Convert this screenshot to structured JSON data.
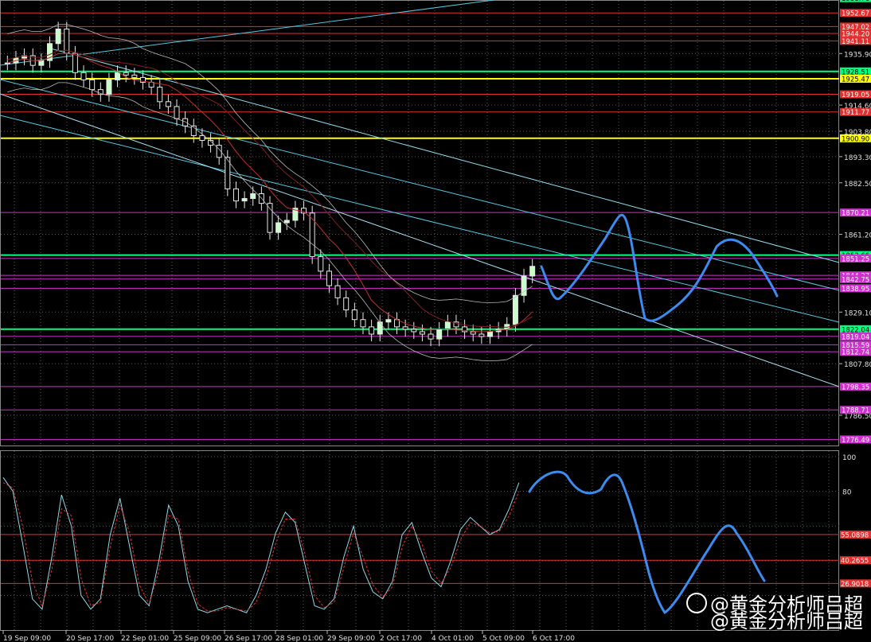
{
  "chart_data": [
    {
      "type": "candlestick",
      "title": "",
      "x_ticks": [
        "19 Sep 09:00",
        "20 Sep 17:00",
        "22 Sep 01:00",
        "25 Sep 09:00",
        "26 Sep 17:00",
        "28 Sep 01:00",
        "29 Sep 09:00",
        "2 Oct 17:00",
        "4 Oct 01:00",
        "5 Oct 09:00",
        "6 Oct 17:00"
      ],
      "y_ticks": [
        1935.9,
        1914.6,
        1903.8,
        1893.3,
        1882.5,
        1861.2,
        1829.1,
        1807.8,
        1786.5
      ],
      "ylim": [
        1774.0,
        1958.0
      ],
      "price_levels": [
        {
          "value": 1958.76,
          "label": "1958.76",
          "color": "#00ff7f"
        },
        {
          "value": 1952.67,
          "label": "1952.67",
          "color": "#e03030"
        },
        {
          "value": 1947.02,
          "label": "1947.02",
          "color": "#e03030"
        },
        {
          "value": 1944.2,
          "label": "1944.20",
          "color": "#e03030"
        },
        {
          "value": 1941.11,
          "label": "1941.11",
          "color": "#e03030"
        },
        {
          "value": 1928.51,
          "label": "1928.51",
          "color": "#00ff7f"
        },
        {
          "value": 1925.47,
          "label": "1925.47",
          "color": "#ffff00"
        },
        {
          "value": 1919.05,
          "label": "1919.05",
          "color": "#e03030"
        },
        {
          "value": 1911.77,
          "label": "1911.77",
          "color": "#e03030"
        },
        {
          "value": 1900.9,
          "label": "1900.90",
          "color": "#ffff00"
        },
        {
          "value": 1870.21,
          "label": "1870.21",
          "color": "#d030d0"
        },
        {
          "value": 1852.66,
          "label": "1852.66",
          "color": "#00ff7f"
        },
        {
          "value": 1851.25,
          "label": "1851.25",
          "color": "#d030d0"
        },
        {
          "value": 1844.27,
          "label": "1844.27",
          "color": "#d030d0"
        },
        {
          "value": 1842.75,
          "label": "1842.75",
          "color": "#d030d0"
        },
        {
          "value": 1838.95,
          "label": "1838.95",
          "color": "#d030d0"
        },
        {
          "value": 1822.04,
          "label": "1822.04",
          "color": "#00ff7f"
        },
        {
          "value": 1819.04,
          "label": "1819.04",
          "color": "#d030d0"
        },
        {
          "value": 1815.59,
          "label": "1815.59",
          "color": "#d030d0"
        },
        {
          "value": 1812.74,
          "label": "1812.74",
          "color": "#d030d0"
        },
        {
          "value": 1798.35,
          "label": "1798.35",
          "color": "#d030d0"
        },
        {
          "value": 1788.71,
          "label": "1788.71",
          "color": "#d030d0"
        },
        {
          "value": 1776.49,
          "label": "1776.49",
          "color": "#d030d0"
        }
      ],
      "close_series": [
        1932,
        1934,
        1935,
        1931,
        1933,
        1940,
        1946,
        1936,
        1928,
        1925,
        1921,
        1919,
        1925,
        1928,
        1927,
        1926,
        1924,
        1922,
        1916,
        1914,
        1909,
        1906,
        1902,
        1900,
        1898,
        1893,
        1880,
        1875,
        1876,
        1878,
        1874,
        1862,
        1866,
        1867,
        1872,
        1870,
        1852,
        1846,
        1840,
        1835,
        1830,
        1826,
        1823,
        1820,
        1825,
        1826,
        1823,
        1822,
        1821,
        1820,
        1818,
        1822,
        1825,
        1823,
        1821,
        1820,
        1819,
        1821,
        1822,
        1824,
        1836,
        1844,
        1848
      ]
    },
    {
      "type": "line",
      "title": "",
      "y_ticks": [
        100,
        80
      ],
      "ylim": [
        0,
        100
      ],
      "levels": [
        {
          "value": 55.0898,
          "label": "55.0898"
        },
        {
          "value": 40.2655,
          "label": "40.2655"
        },
        {
          "value": 26.9018,
          "label": "26.9018"
        }
      ],
      "k_series": [
        88,
        80,
        50,
        18,
        12,
        42,
        78,
        60,
        20,
        12,
        18,
        55,
        76,
        48,
        20,
        14,
        40,
        72,
        60,
        28,
        12,
        10,
        12,
        14,
        12,
        10,
        20,
        35,
        56,
        68,
        62,
        38,
        14,
        12,
        18,
        42,
        60,
        35,
        22,
        18,
        28,
        55,
        62,
        45,
        30,
        25,
        40,
        58,
        65,
        60,
        55,
        58,
        70,
        85
      ],
      "d_series": [
        85,
        82,
        60,
        28,
        14,
        35,
        70,
        66,
        30,
        14,
        16,
        48,
        72,
        56,
        26,
        15,
        34,
        66,
        64,
        34,
        15,
        11,
        11,
        13,
        12,
        11,
        16,
        30,
        50,
        64,
        64,
        44,
        20,
        13,
        16,
        36,
        56,
        42,
        26,
        19,
        25,
        48,
        60,
        50,
        34,
        27,
        36,
        52,
        62,
        60,
        56,
        57,
        66,
        80
      ]
    }
  ],
  "watermark": {
    "line1": "@黄金分析师吕超",
    "line2": "@黄金分析师吕超"
  }
}
